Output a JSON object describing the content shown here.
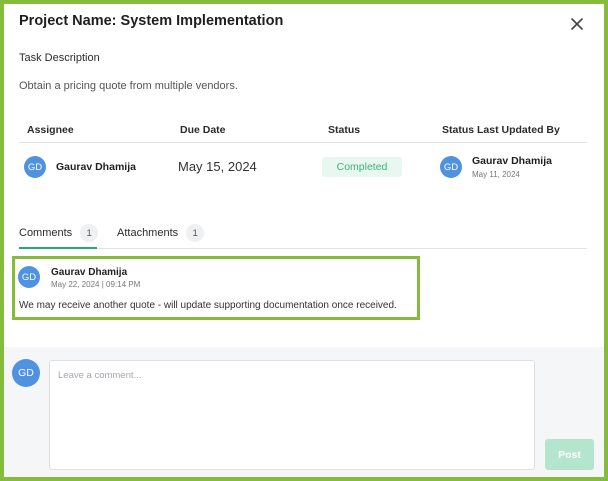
{
  "modal": {
    "title": "Project Name: System Implementation",
    "close_icon": "close-icon"
  },
  "task": {
    "label": "Task Description",
    "description": "Obtain a pricing quote from multiple vendors."
  },
  "table": {
    "headers": [
      "Assignee",
      "Due Date",
      "Status",
      "Status Last Updated By"
    ],
    "assignee": {
      "initials": "GD",
      "name": "Gaurav Dhamija"
    },
    "due_date": "May 15, 2024",
    "status": "Completed",
    "updated_by": {
      "initials": "GD",
      "name": "Gaurav Dhamija",
      "date": "May 11, 2024"
    }
  },
  "tabs": [
    {
      "label": "Comments",
      "count": "1",
      "active": true
    },
    {
      "label": "Attachments",
      "count": "1",
      "active": false
    }
  ],
  "comments": [
    {
      "initials": "GD",
      "author": "Gaurav Dhamija",
      "timestamp": "May 22, 2024 | 09:14 PM",
      "text": "We may receive another quote - will update supporting documentation once received."
    }
  ],
  "composer": {
    "initials": "GD",
    "placeholder": "Leave a comment...",
    "post_label": "Post"
  },
  "colors": {
    "highlight_border": "#86bc3b",
    "avatar": "#4f93e0",
    "status_text": "#3fb27a",
    "status_bg": "#e8f7ef",
    "tab_active": "#2aa872",
    "post_button": "#b4e6cf"
  }
}
